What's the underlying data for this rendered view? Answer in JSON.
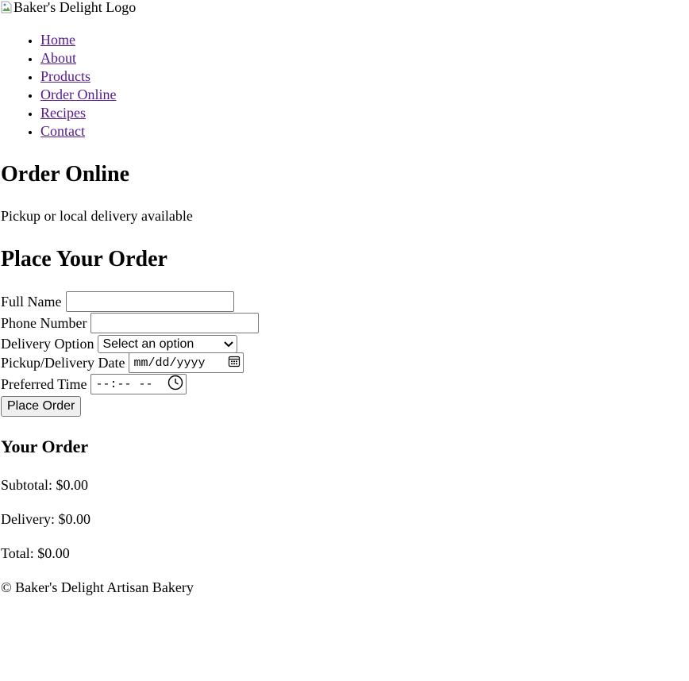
{
  "header": {
    "logo_alt": "Baker's Delight Logo"
  },
  "nav": {
    "items": [
      {
        "label": "Home"
      },
      {
        "label": "About"
      },
      {
        "label": "Products"
      },
      {
        "label": "Order Online"
      },
      {
        "label": "Recipes"
      },
      {
        "label": "Contact"
      }
    ]
  },
  "hero": {
    "title": "Order Online",
    "subtitle": "Pickup or local delivery available"
  },
  "form": {
    "title": "Place Your Order",
    "full_name_label": "Full Name",
    "full_name_value": "",
    "phone_label": "Phone Number",
    "phone_value": "",
    "delivery_label": "Delivery Option",
    "delivery_selected": "Select an option",
    "date_label": "Pickup/Delivery Date",
    "date_placeholder": "mm/dd/yyyy",
    "time_label": "Preferred Time",
    "time_placeholder": "--:-- --",
    "submit_label": "Place Order"
  },
  "summary": {
    "title": "Your Order",
    "subtotal": "Subtotal: $0.00",
    "delivery": "Delivery: $0.00",
    "total": "Total: $0.00"
  },
  "footer": {
    "copyright": "© Baker's Delight Artisan Bakery"
  },
  "icons": {
    "broken_image": "broken-image-icon",
    "calendar": "calendar-icon",
    "clock": "clock-icon",
    "dropdown": "chevron-down-icon"
  },
  "colors": {
    "link_visited": "#551a8b",
    "button_bg": "#efefef",
    "border": "#767676"
  }
}
